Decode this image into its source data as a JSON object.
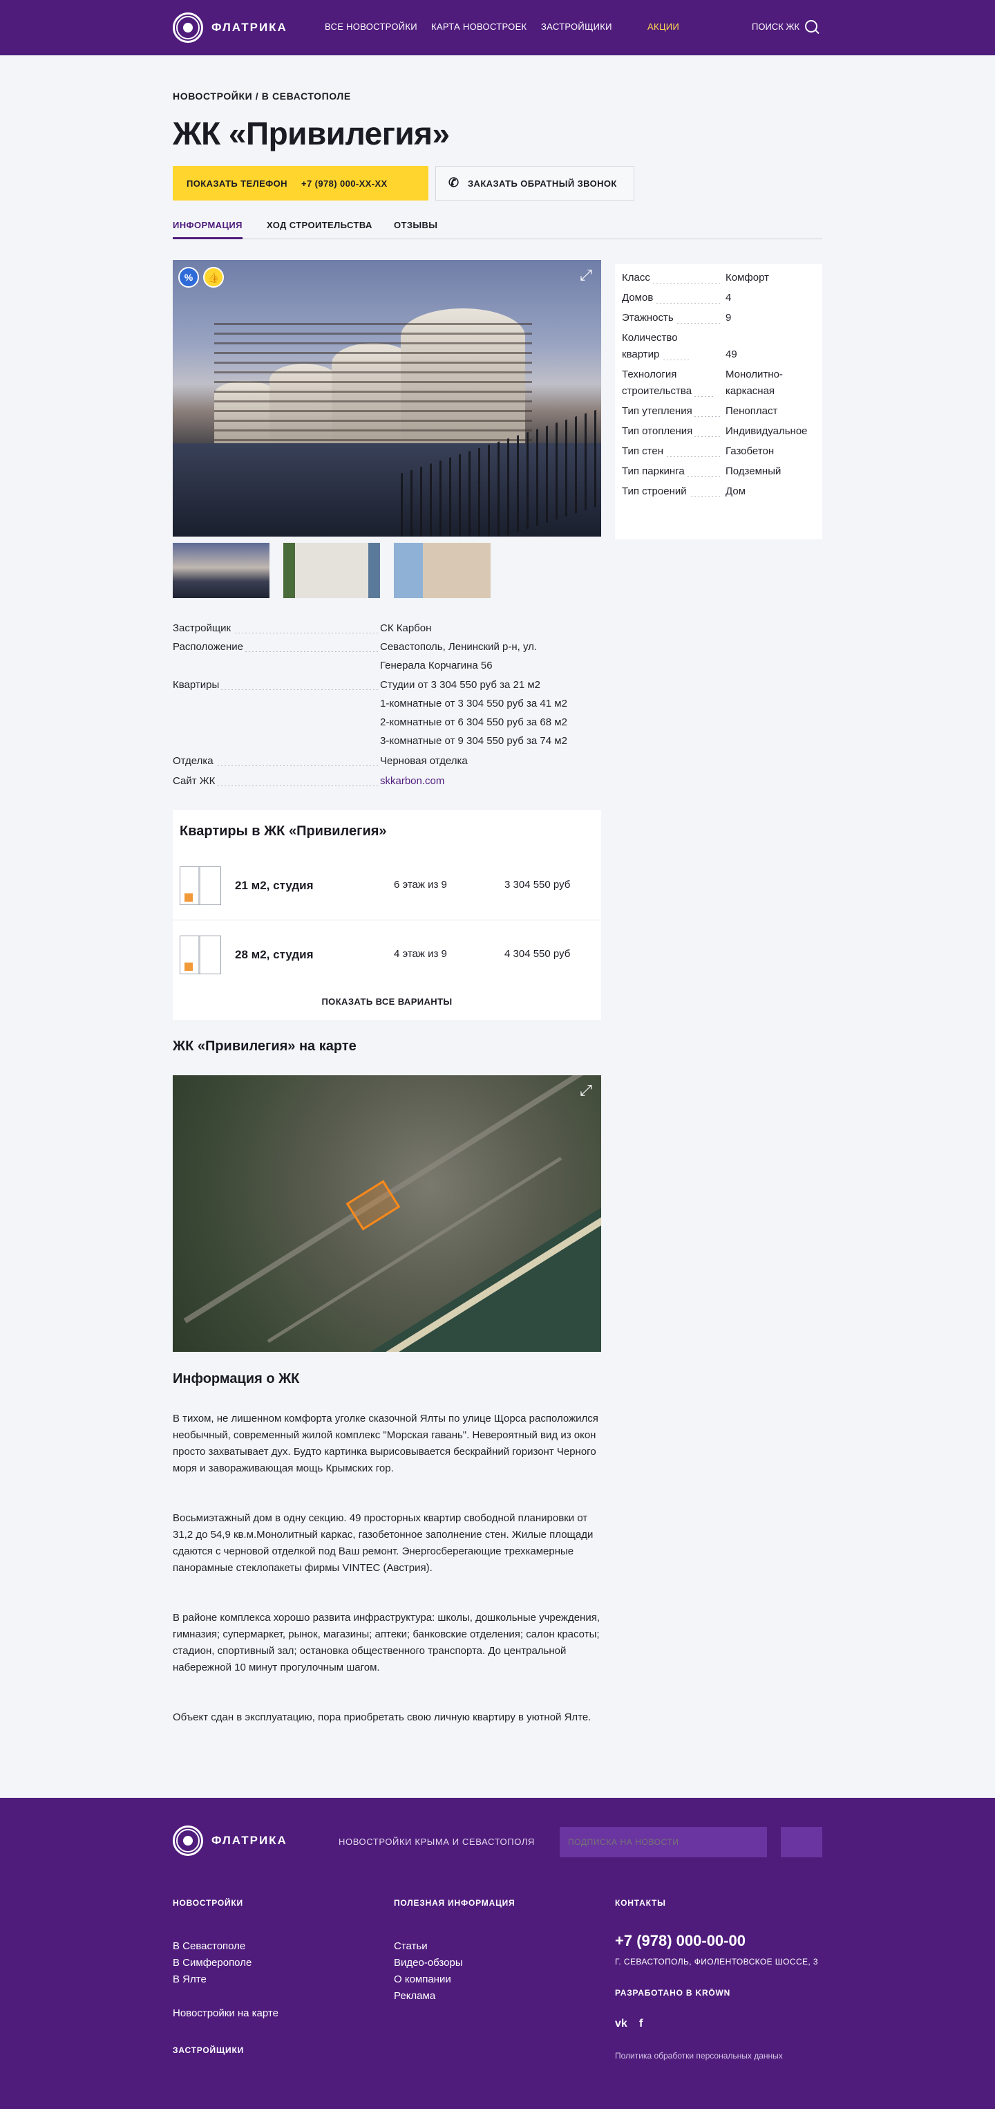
{
  "header": {
    "logo_text": "ФЛАТРИКА",
    "nav": [
      "ВСЕ НОВОСТРОЙКИ",
      "КАРТА НОВОСТРОЕК",
      "ЗАСТРОЙЩИКИ",
      "АКЦИИ"
    ],
    "search_label": "ПОИСК ЖК",
    "accent_color": "#ffd84d",
    "bg_color": "#4f1c7c"
  },
  "breadcrumb": "НОВОСТРОЙКИ / В СЕВАСТОПОЛЕ",
  "title": "ЖК «Привилегия»",
  "actions": {
    "show_phone": "ПОКАЗАТЬ ТЕЛЕФОН",
    "phone": "+7 (978) 000-ХХ-ХХ",
    "callback": "ЗАКАЗАТЬ ОБРАТНЫЙ ЗВОНОК"
  },
  "tabs": [
    "ИНФОРМАЦИЯ",
    "ХОД СТРОИТЕЛЬСТВА",
    "ОТЗЫВЫ"
  ],
  "badges": {
    "percent": "%",
    "like": "👍"
  },
  "specs": [
    {
      "k": "Класс",
      "v": "Комфорт"
    },
    {
      "k": "Домов",
      "v": "4"
    },
    {
      "k": "Этажность",
      "v": "9"
    },
    {
      "k": "Количество квартир",
      "v": "49"
    },
    {
      "k": "Технология строительства",
      "v": "Монолитно-каркасная"
    },
    {
      "k": "Тип утепления",
      "v": "Пенопласт"
    },
    {
      "k": "Тип отопления",
      "v": "Индивидуальное"
    },
    {
      "k": "Тип стен",
      "v": "Газобетон"
    },
    {
      "k": "Тип паркинга",
      "v": "Подземный"
    },
    {
      "k": "Тип строений",
      "v": "Дом"
    }
  ],
  "details": {
    "developer_k": "Застройщик",
    "developer_v": "СК Карбон",
    "location_k": "Расположение",
    "location_v": "Севастополь, Ленинский р-н, ул. Генерала Корчагина 56",
    "apartments_k": "Квартиры",
    "apartments_v": [
      "Студии от 3 304 550 руб за 21 м2",
      "1-комнатные от 3 304 550 руб за 41 м2",
      "2-комнатные от 6 304 550 руб за 68 м2",
      "3-комнатные от 9 304 550 руб за 74 м2"
    ],
    "finish_k": "Отделка",
    "finish_v": "Черновая отделка",
    "site_k": "Сайт ЖК",
    "site_v": "skkarbon.com"
  },
  "apartments": {
    "title": "Квартиры в ЖК «Привилегия»",
    "items": [
      {
        "size": "21 м2, студия",
        "floor": "6 этаж из 9",
        "price": "3 304 550 руб"
      },
      {
        "size": "28 м2, студия",
        "floor": "4 этаж из 9",
        "price": "4 304 550 руб"
      }
    ],
    "show_all": "ПОКАЗАТЬ ВСЕ ВАРИАНТЫ"
  },
  "map_title": "ЖК «Привилегия» на карте",
  "info": {
    "title": "Информация о ЖК",
    "paragraphs": [
      "В тихом, не лишенном комфорта уголке сказочной Ялты по улице Щорса расположился необычный, современный жилой комплекс \"Морская гавань\". Невероятный вид из окон просто захватывает дух. Будто картинка вырисовывается бескрайний горизонт Черного моря и завораживающая мощь Крымских гор.",
      "Восьмиэтажный дом в одну секцию. 49 просторных квартир свободной планировки от 31,2 до 54,9 кв.м.Монолитный каркас, газобетонное заполнение стен. Жилые площади сдаются с черновой отделкой под Ваш ремонт. Энергосберегающие трехкамерные панорамные стеклопакеты фирмы VINTEC (Австрия).",
      "В районе комплекса хорошо развита инфраструктура: школы, дошкольные учреждения, гимназия; супермаркет, рынок, магазины; аптеки; банковские отделения; салон красоты; стадион, спортивный зал; остановка общественного транспорта. До центральной набережной 10 минут прогулочным шагом.",
      "Объект сдан в эксплуатацию, пора приобретать свою личную квартиру в уютной Ялте."
    ]
  },
  "footer": {
    "logo_text": "ФЛАТРИКА",
    "tagline": "НОВОСТРОЙКИ КРЫМА И СЕВАСТОПОЛЯ",
    "subscribe_placeholder": "ПОДПИСКА НА НОВОСТИ",
    "col1_title": "НОВОСТРОЙКИ",
    "col1_links": [
      "В Севастополе",
      "В Симферополе",
      "В Ялте"
    ],
    "col1_map": "Новостройки на карте",
    "col1_dev": "ЗАСТРОЙЩИКИ",
    "col2_title": "ПОЛЕЗНАЯ ИНФОРМАЦИЯ",
    "col2_links": [
      "Статьи",
      "Видео-обзоры",
      "О компании",
      "Реклама"
    ],
    "col3_title": "КОНТАКТЫ",
    "phone": "+7 (978) 000-00-00",
    "address": "Г. СЕВАСТОПОЛЬ, ФИОЛЕНТОВСКОЕ ШОССЕ, 3",
    "developed_by": "РАЗРАБОТАНО В KRŌWN",
    "social_vk": "vk",
    "social_fb": "f",
    "policy": "Политика обработки персональных данных"
  }
}
